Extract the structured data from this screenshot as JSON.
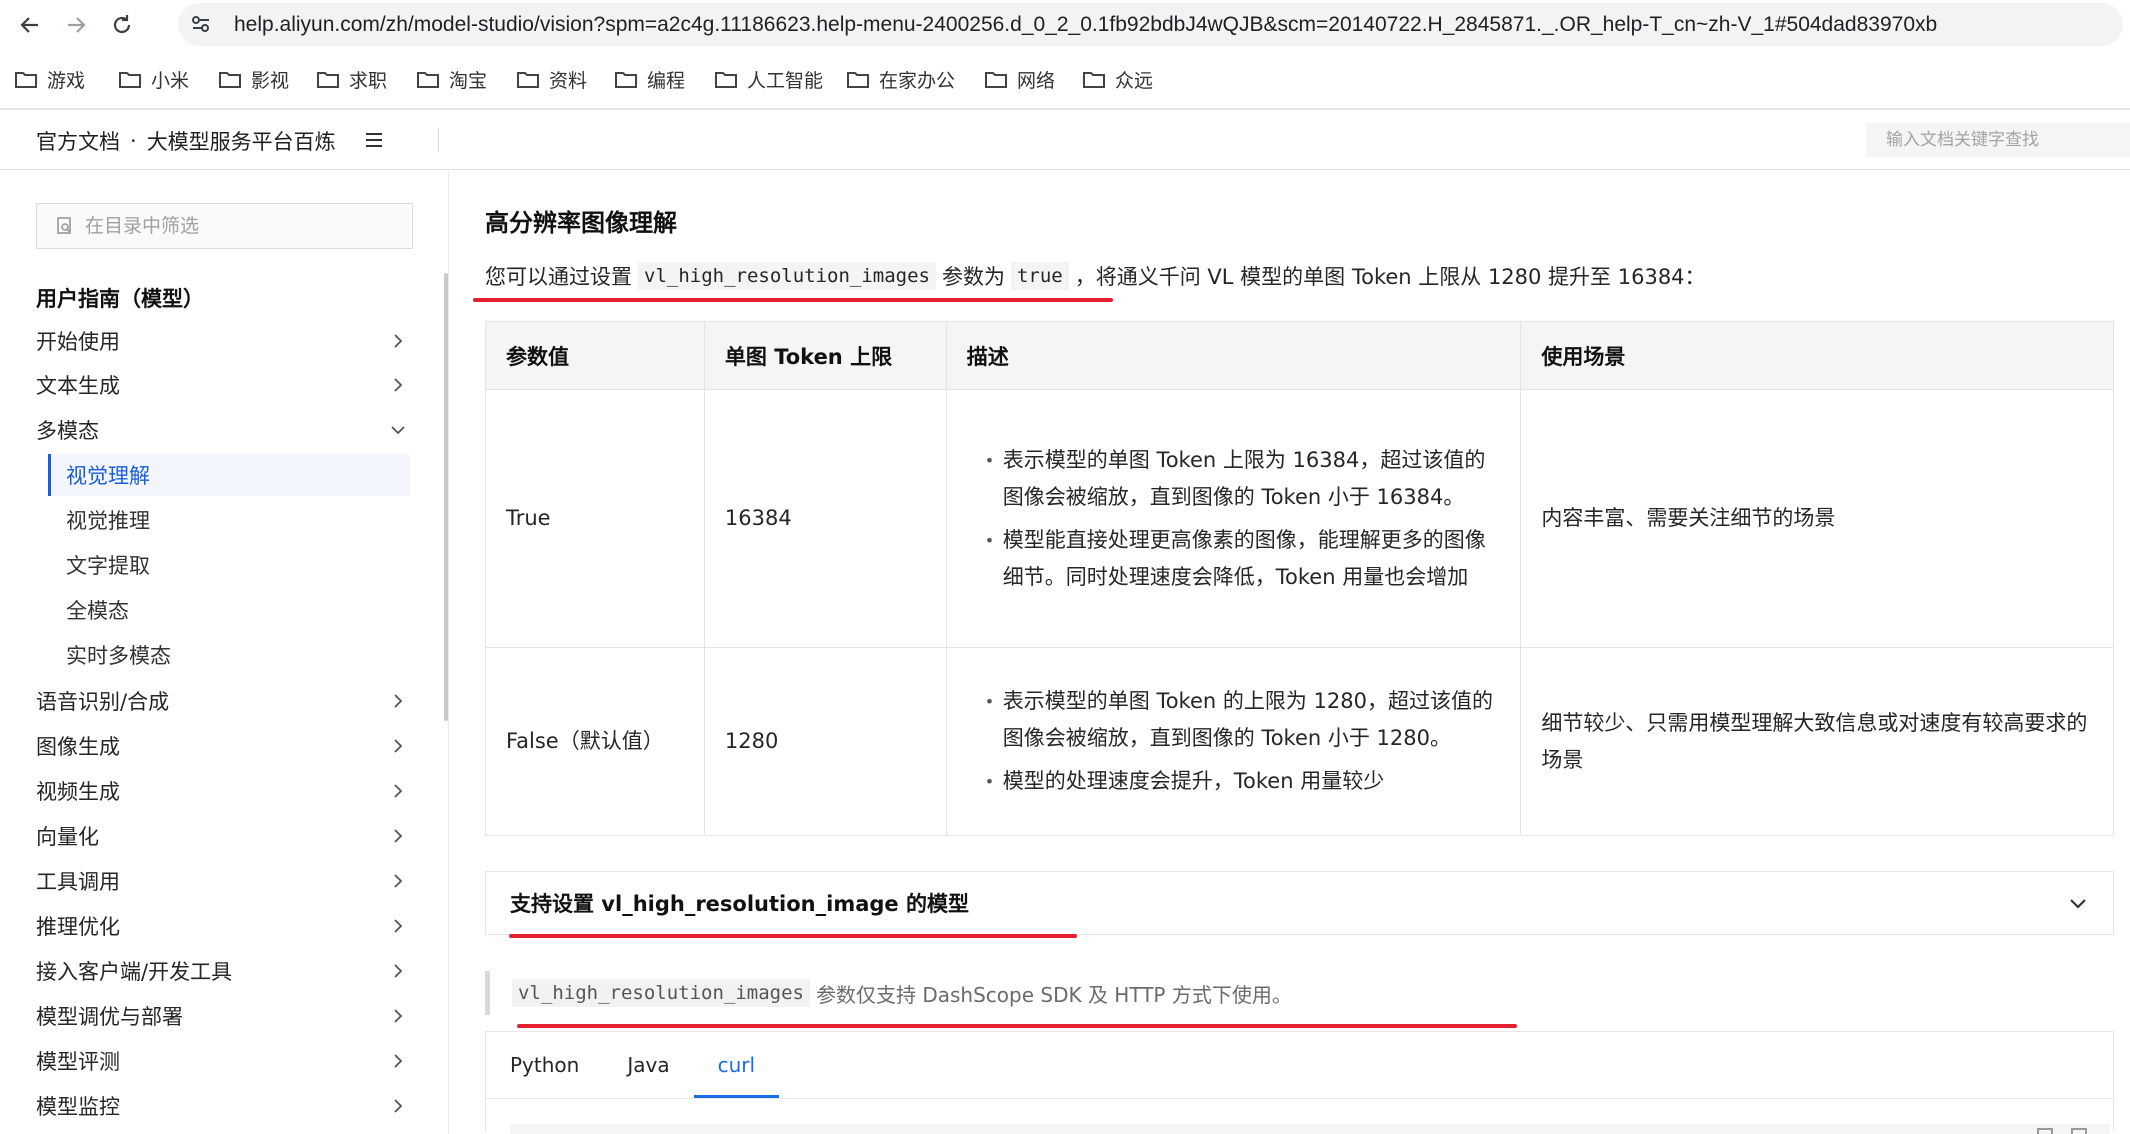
{
  "browser": {
    "url": "help.aliyun.com/zh/model-studio/vision?spm=a2c4g.11186623.help-menu-2400256.d_0_2_0.1fb92bdbJ4wQJB&scm=20140722.H_2845871._.OR_help-T_cn~zh-V_1#504dad83970xb",
    "bookmarks": [
      "游戏",
      "小米",
      "影视",
      "求职",
      "淘宝",
      "资料",
      "编程",
      "人工智能",
      "在家办公",
      "网络",
      "众远"
    ]
  },
  "header": {
    "site": "官方文档",
    "separator": "·",
    "product": "大模型服务平台百炼",
    "search_placeholder": "输入文档关键字查找"
  },
  "sidebar": {
    "filter_placeholder": "在目录中筛选",
    "section_title": "用户指南（模型）",
    "items": [
      {
        "label": "开始使用",
        "chevron": "right"
      },
      {
        "label": "文本生成",
        "chevron": "right"
      },
      {
        "label": "多模态",
        "chevron": "down"
      },
      {
        "label": "语音识别/合成",
        "chevron": "right"
      },
      {
        "label": "图像生成",
        "chevron": "right"
      },
      {
        "label": "视频生成",
        "chevron": "right"
      },
      {
        "label": "向量化",
        "chevron": "right"
      },
      {
        "label": "工具调用",
        "chevron": "right"
      },
      {
        "label": "推理优化",
        "chevron": "right"
      },
      {
        "label": "接入客户端/开发工具",
        "chevron": "right"
      },
      {
        "label": "模型调优与部署",
        "chevron": "right"
      },
      {
        "label": "模型评测",
        "chevron": "right"
      },
      {
        "label": "模型监控",
        "chevron": "right"
      }
    ],
    "subitems": [
      {
        "label": "视觉理解",
        "active": true
      },
      {
        "label": "视觉推理",
        "active": false
      },
      {
        "label": "文字提取",
        "active": false
      },
      {
        "label": "全模态",
        "active": false
      },
      {
        "label": "实时多模态",
        "active": false
      }
    ]
  },
  "content": {
    "heading": "高分辨率图像理解",
    "para_prefix": "您可以通过设置",
    "para_code": "vl_high_resolution_images",
    "para_mid": "参数为",
    "para_code2": "true",
    "para_suffix": "，将通义千问 VL 模型的单图 Token 上限从 1280 提升至 16384：",
    "table": {
      "headers": [
        "参数值",
        "单图 Token 上限",
        "描述",
        "使用场景"
      ],
      "rows": [
        {
          "value": "True",
          "limit": "16384",
          "desc": [
            "表示模型的单图 Token 上限为 16384，超过该值的图像会被缩放，直到图像的 Token 小于 16384。",
            "模型能直接处理更高像素的图像，能理解更多的图像细节。同时处理速度会降低，Token 用量也会增加"
          ],
          "scene": "内容丰富、需要关注细节的场景"
        },
        {
          "value": "False（默认值）",
          "limit": "1280",
          "desc": [
            "表示模型的单图 Token 的上限为 1280，超过该值的图像会被缩放，直到图像的 Token 小于 1280。",
            "模型的处理速度会提升，Token 用量较少"
          ],
          "scene": "细节较少、只需用模型理解大致信息或对速度有较高要求的场景"
        }
      ]
    },
    "collapse_title": "支持设置 vl_high_resolution_image 的模型",
    "note_code": "vl_high_resolution_images",
    "note_text": "参数仅支持 DashScope SDK 及 HTTP 方式下使用。",
    "tabs": [
      {
        "label": "Python",
        "active": false
      },
      {
        "label": "Java",
        "active": false
      },
      {
        "label": "curl",
        "active": true
      }
    ]
  },
  "colors": {
    "accent": "#1a6ce8",
    "annotation_red": "#e5202e"
  }
}
